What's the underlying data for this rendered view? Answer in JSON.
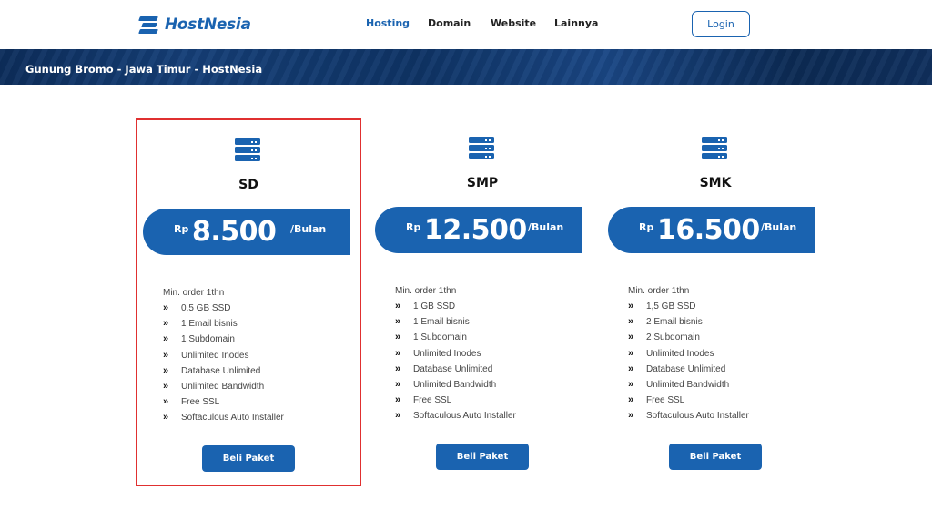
{
  "brand": {
    "name": "HostNesia",
    "color": "#1a63b0"
  },
  "nav": {
    "items": [
      {
        "label": "Hosting",
        "active": true
      },
      {
        "label": "Domain",
        "active": false
      },
      {
        "label": "Website",
        "active": false
      },
      {
        "label": "Lainnya",
        "active": false
      }
    ],
    "login_label": "Login"
  },
  "banner": {
    "text": "Gunung Bromo - Jawa Timur - HostNesia"
  },
  "plans": [
    {
      "name": "SD",
      "icon": "server-icon",
      "currency": "Rp",
      "price": "8.500",
      "period": "/Bulan",
      "min_order": "Min. order 1thn",
      "features": [
        "0,5 GB SSD",
        "1 Email bisnis",
        "1 Subdomain",
        "Unlimited Inodes",
        "Database Unlimited",
        "Unlimited Bandwidth",
        "Free SSL",
        "Softaculous Auto Installer"
      ],
      "button_label": "Beli Paket",
      "highlighted": true
    },
    {
      "name": "SMP",
      "icon": "server-icon",
      "currency": "Rp",
      "price": "12.500",
      "period": "/Bulan",
      "min_order": "Min. order 1thn",
      "features": [
        "1 GB SSD",
        "1 Email bisnis",
        "1 Subdomain",
        "Unlimited Inodes",
        "Database Unlimited",
        "Unlimited Bandwidth",
        "Free SSL",
        "Softaculous Auto Installer"
      ],
      "button_label": "Beli Paket",
      "highlighted": false
    },
    {
      "name": "SMK",
      "icon": "server-icon",
      "currency": "Rp",
      "price": "16.500",
      "period": "/Bulan",
      "min_order": "Min. order 1thn",
      "features": [
        "1,5 GB SSD",
        "2 Email bisnis",
        "2 Subdomain",
        "Unlimited Inodes",
        "Database Unlimited",
        "Unlimited Bandwidth",
        "Free SSL",
        "Softaculous Auto Installer"
      ],
      "button_label": "Beli Paket",
      "highlighted": false
    }
  ],
  "colors": {
    "primary": "#1a63b0",
    "highlight_border": "#e03030"
  }
}
